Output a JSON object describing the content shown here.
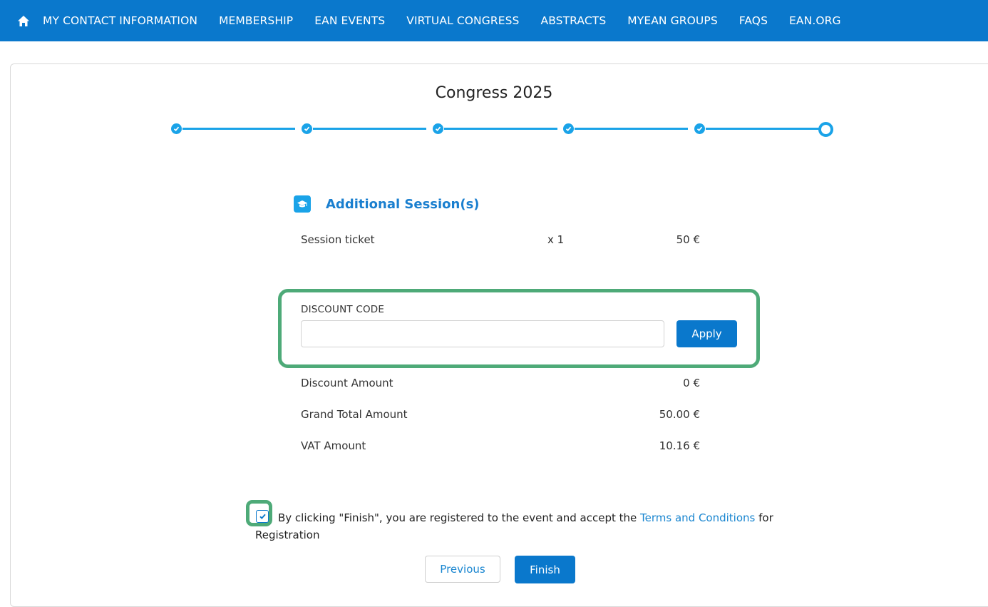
{
  "nav": {
    "home_icon": "home-icon",
    "items": [
      {
        "label": "MY CONTACT INFORMATION"
      },
      {
        "label": "MEMBERSHIP"
      },
      {
        "label": "EAN EVENTS"
      },
      {
        "label": "VIRTUAL CONGRESS"
      },
      {
        "label": "ABSTRACTS"
      },
      {
        "label": "MYEAN GROUPS"
      },
      {
        "label": "FAQS"
      },
      {
        "label": "EAN.ORG"
      }
    ]
  },
  "page": {
    "title": "Congress 2025"
  },
  "stepper": {
    "completed_steps": 5,
    "total_steps": 6,
    "current_step": 6
  },
  "section": {
    "icon": "graduation-cap-icon",
    "title": "Additional Session(s)"
  },
  "items": [
    {
      "label": "Session ticket",
      "qty": "x 1",
      "amount": "50 €"
    }
  ],
  "discount": {
    "label": "DISCOUNT CODE",
    "value": "",
    "apply_label": "Apply"
  },
  "summary": [
    {
      "label": "Discount Amount",
      "amount": "0 €"
    },
    {
      "label": "Grand Total Amount",
      "amount": "50.00 €"
    },
    {
      "label": "VAT Amount",
      "amount": "10.16 €"
    }
  ],
  "terms": {
    "checked": true,
    "text_before": "By clicking \"Finish\", you are registered to the event and accept the ",
    "link_text": "Terms and Conditions",
    "text_after": " for Registration"
  },
  "buttons": {
    "previous": "Previous",
    "finish": "Finish"
  },
  "colors": {
    "nav_bg": "#0a78cc",
    "accent": "#1aa3e8",
    "highlight": "#4eaa78"
  }
}
